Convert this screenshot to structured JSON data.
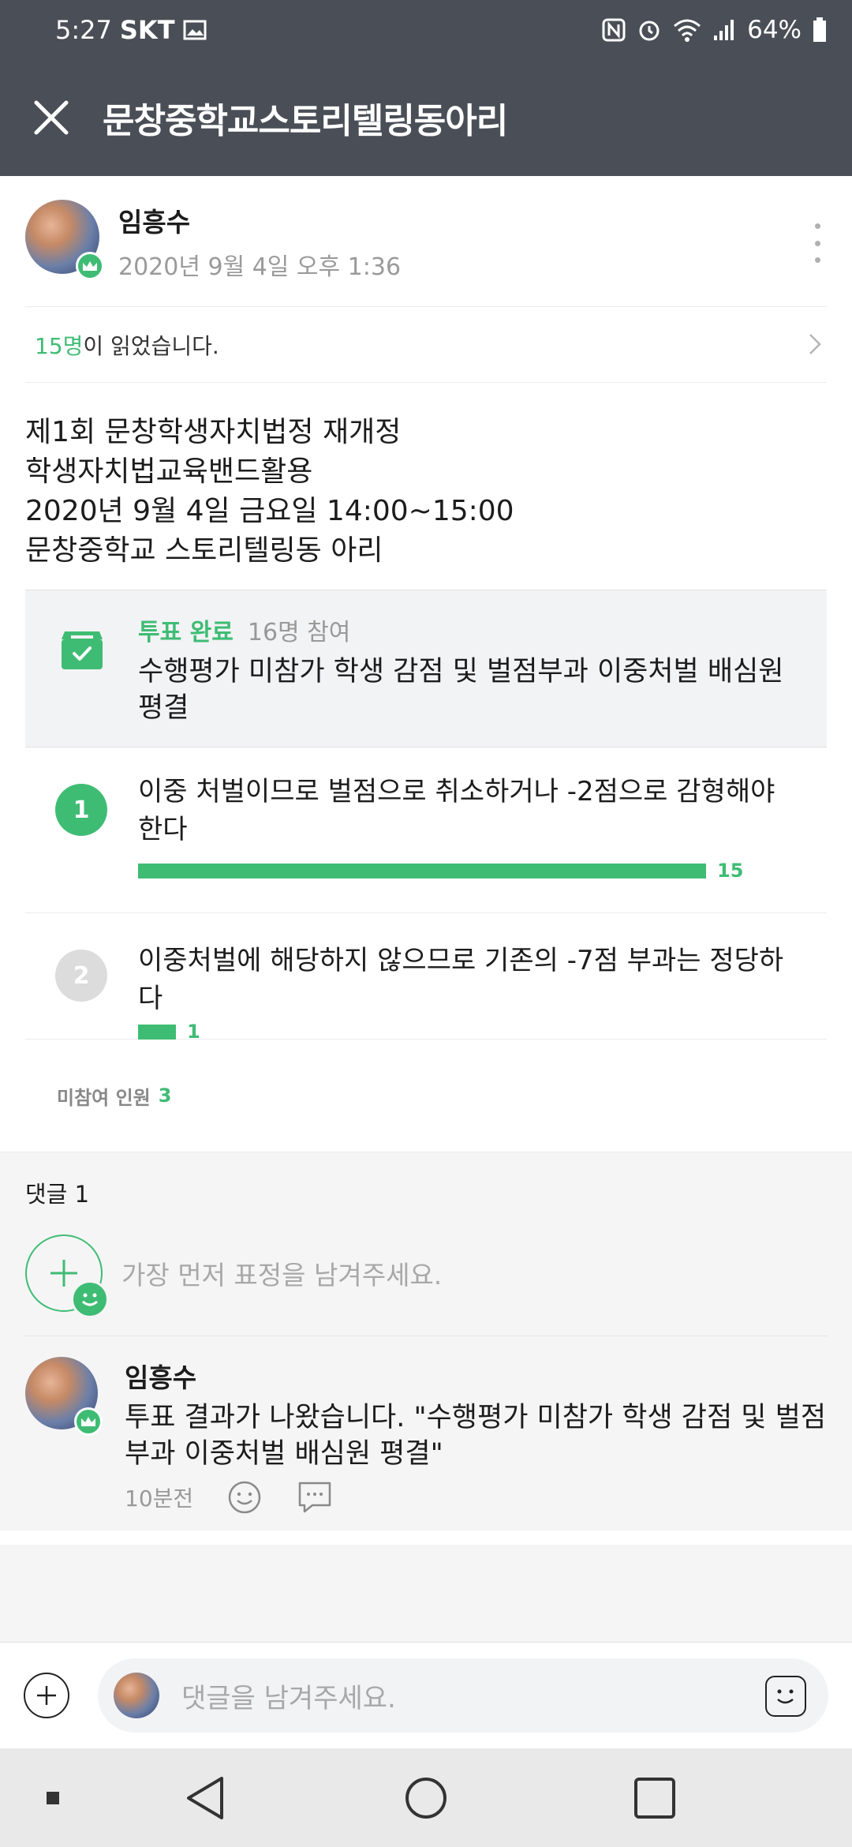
{
  "status_bar": {
    "time": "5:27",
    "carrier": "SKT",
    "battery": "64%"
  },
  "header": {
    "title": "문창중학교스토리텔링동아리"
  },
  "post": {
    "author": "임흥수",
    "date": "2020년 9월 4일 오후 1:36",
    "read_count": "15명",
    "read_suffix": "이 읽었습니다.",
    "body_lines": [
      "제1회 문창학생자치법정 재개정",
      "학생자치법교육밴드활용",
      "2020년 9월 4일 금요일 14:00~15:00",
      "문창중학교 스토리텔링동 아리"
    ]
  },
  "vote": {
    "status": "투표 완료",
    "participants": "16명 참여",
    "question": "수행평가 미참가 학생 감점 및 벌점부과 이중처벌 배심원 평결",
    "options": [
      {
        "num": "1",
        "text": "이중 처벌이므로 벌점으로 취소하거나 -2점으로 감형해야 한다",
        "votes": "15",
        "fraction": 0.9375,
        "selected": true
      },
      {
        "num": "2",
        "text": "이중처벌에 해당하지 않으므로 기존의 -7점 부과는 정당하다",
        "votes": "1",
        "fraction": 0.0625,
        "selected": false
      }
    ],
    "nonparticipant_label": "미참여 인원",
    "nonparticipant_count": "3"
  },
  "comments": {
    "header": "댓글 1",
    "emotion_hint": "가장 먼저 표정을 남겨주세요.",
    "items": [
      {
        "author": "임흥수",
        "text": "투표 결과가 나왔습니다. \"수행평가 미참가 학생 감점 및 벌점부과 이중처벌 배심원 평결\"",
        "time": "10분전"
      }
    ]
  },
  "composer": {
    "placeholder": "댓글을 남겨주세요."
  },
  "colors": {
    "accent": "#3fbc74",
    "appbar": "#4a4f57",
    "muted": "#9a9a9a"
  },
  "icons": {
    "close": "close-icon",
    "more": "more-vertical-icon",
    "chevron": "chevron-right-icon",
    "vote": "ballot-box-icon",
    "smile": "smile-icon",
    "reply": "reply-bubble-icon",
    "plus": "plus-circle-icon",
    "emoticon": "emoticon-icon"
  }
}
